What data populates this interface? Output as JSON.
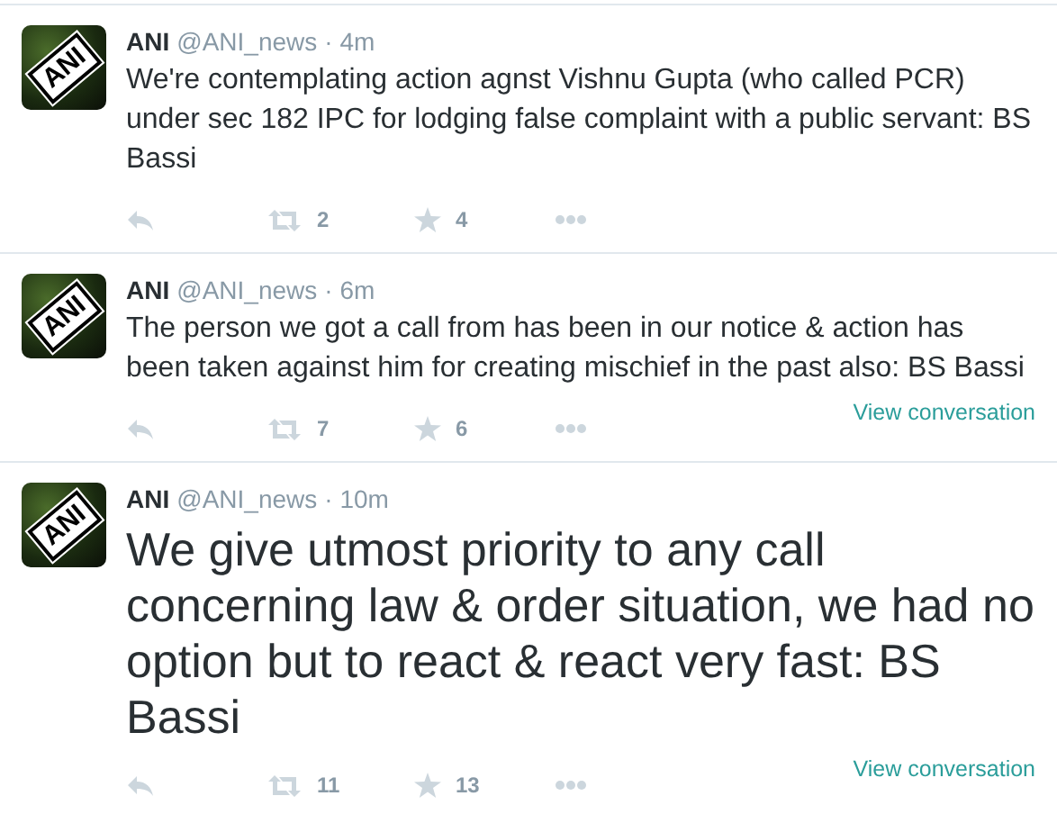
{
  "tweets": [
    {
      "avatar_text": "ANI",
      "name": "ANI",
      "handle": "@ANI_news",
      "time": "· 4m",
      "text": "We're contemplating action agnst Vishnu Gupta (who called PCR) under sec 182 IPC for lodging false complaint with a public servant: BS Bassi",
      "kind": "normal",
      "retweets": "2",
      "favorites": "4"
    },
    {
      "avatar_text": "ANI",
      "name": "ANI",
      "handle": "@ANI_news",
      "time": "· 6m",
      "text": "The person we got a call from has been in our notice & action has been taken against him for creating mischief in the past also: BS Bassi",
      "kind": "normal",
      "retweets": "7",
      "favorites": "6",
      "link": "View conversation"
    },
    {
      "avatar_text": "ANI",
      "name": "ANI",
      "handle": "@ANI_news",
      "time": "· 10m",
      "text": "We give utmost priority to any call concerning law & order situation, we had no option but to react & react very fast: BS Bassi",
      "kind": "large",
      "retweets": "11",
      "favorites": "13",
      "link": "View conversation"
    }
  ]
}
